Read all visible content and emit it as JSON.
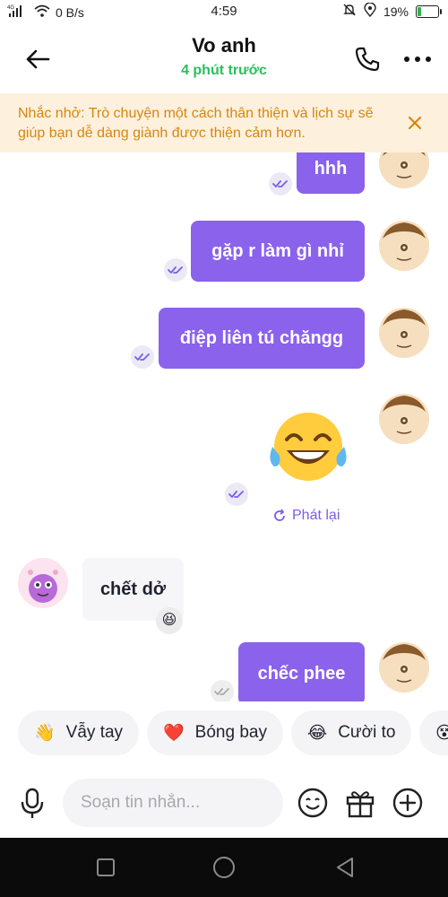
{
  "status_bar": {
    "network": "4G",
    "speed": "0 B/s",
    "time": "4:59",
    "battery_percent": "19%",
    "battery_level": 0.19,
    "icons": [
      "signal-icon",
      "wifi-icon",
      "alarm-off-icon",
      "location-icon",
      "battery-icon"
    ]
  },
  "header": {
    "name": "Vo anh",
    "last_seen": "4 phút trước",
    "icons": [
      "back-arrow-icon",
      "phone-icon",
      "more-icon"
    ]
  },
  "reminder": {
    "text": "Nhắc nhở: Trò chuyện một cách thân thiện và lịch sự sẽ giúp bạn dễ dàng giành được thiện cảm hơn.",
    "close_icon": "close-icon",
    "color": "#d8860f",
    "background": "#fdf1de"
  },
  "messages": [
    {
      "direction": "out",
      "type": "text",
      "text": "hhh",
      "status": "read"
    },
    {
      "direction": "out",
      "type": "text",
      "text": "gặp r làm gì nhỉ",
      "status": "read"
    },
    {
      "direction": "out",
      "type": "text",
      "text": "điệp liên tú chăngg",
      "status": "read"
    },
    {
      "direction": "out",
      "type": "emoji",
      "emoji": "😂",
      "status": "read",
      "replay_label": "Phát lại"
    },
    {
      "direction": "in",
      "type": "text",
      "text": "chết dở",
      "reaction": "😆"
    },
    {
      "direction": "out",
      "type": "text",
      "text": "chếc phee",
      "status": "sent"
    }
  ],
  "quick_replies": [
    {
      "emoji": "👋",
      "label": "Vẫy tay"
    },
    {
      "emoji": "❤️",
      "label": "Bóng bay"
    },
    {
      "emoji": "😂",
      "label": "Cười to"
    },
    {
      "emoji": "😵",
      "label": ""
    }
  ],
  "composer": {
    "placeholder": "Soạn tin nhắn...",
    "icons": [
      "microphone-icon",
      "emoji-icon",
      "gift-icon",
      "add-icon"
    ]
  },
  "colors": {
    "accent": "#8a62ec",
    "online": "#2bbf5e",
    "tick": "#7d5ce8"
  },
  "nav": {
    "icons": [
      "recent-apps-icon",
      "home-icon",
      "back-icon"
    ]
  }
}
